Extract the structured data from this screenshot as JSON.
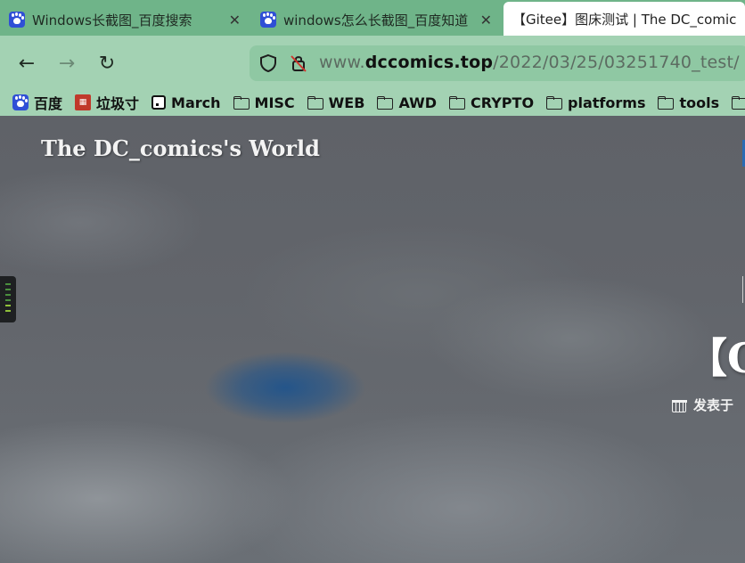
{
  "tabs": [
    {
      "title": "Windows长截图_百度搜索",
      "close": "✕"
    },
    {
      "title": "windows怎么长截图_百度知道",
      "close": "✕"
    },
    {
      "title": "【Gitee】图床测试 | The DC_comics's World",
      "close": ""
    }
  ],
  "nav": {
    "back": "←",
    "forward": "→",
    "reload": "↻"
  },
  "url": {
    "subdomain": "www.",
    "domain": "dccomics.top",
    "path": "/2022/03/25/03251740_test/"
  },
  "bookmarks": [
    {
      "label": "百度",
      "icon": "baidu-icon"
    },
    {
      "label": "垃圾寸",
      "icon": "lajicun-icon"
    },
    {
      "label": "March",
      "icon": "march-icon"
    },
    {
      "label": "MISC",
      "icon": "folder-icon"
    },
    {
      "label": "WEB",
      "icon": "folder-icon"
    },
    {
      "label": "AWD",
      "icon": "folder-icon"
    },
    {
      "label": "CRYPTO",
      "icon": "folder-icon"
    },
    {
      "label": "platforms",
      "icon": "folder-icon"
    },
    {
      "label": "tools",
      "icon": "folder-icon"
    },
    {
      "label": "",
      "icon": "folder-icon"
    }
  ],
  "page": {
    "site_title": "The DC_comics's World",
    "post_title_visible": "【G",
    "post_meta_label": "发表于"
  },
  "colors": {
    "tab_strip": "#6fb489",
    "toolbar": "#a3d2b3",
    "urlbox": "#8fc8a3",
    "accent": "#2a6bb3"
  }
}
